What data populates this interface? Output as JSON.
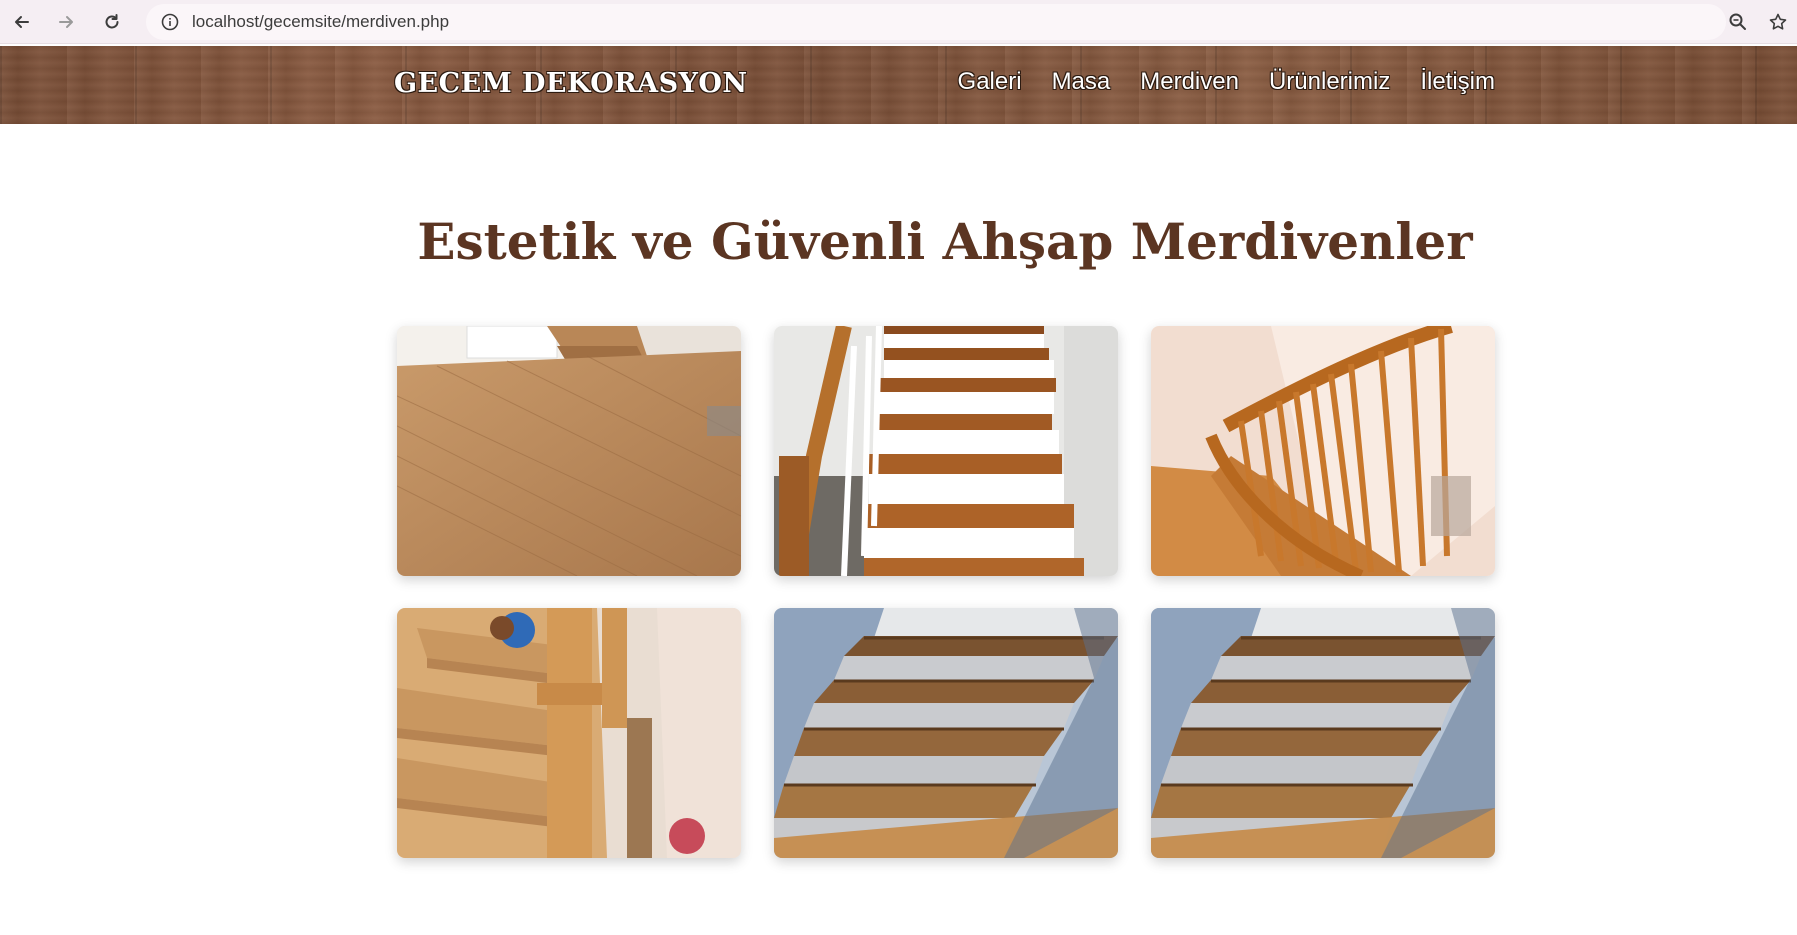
{
  "browser": {
    "url": "localhost/gecemsite/merdiven.php",
    "icons": [
      "back-arrow-icon",
      "forward-arrow-icon",
      "reload-icon",
      "site-info-icon",
      "zoom-icon",
      "bookmark-star-icon"
    ]
  },
  "header": {
    "brand": "GECEM DEKORASYON",
    "nav": [
      "Galeri",
      "Masa",
      "Merdiven",
      "Ürünlerimiz",
      "İletişim"
    ]
  },
  "main": {
    "title": "Estetik ve Güvenli Ahşap Merdivenler",
    "gallery": [
      {
        "subject": "wood parquet floor with staircase"
      },
      {
        "subject": "wooden stair treads with white balusters"
      },
      {
        "subject": "spiral staircase wooden railing"
      },
      {
        "subject": "pine wood staircase newel post"
      },
      {
        "subject": "oak stair treads with grey risers"
      },
      {
        "subject": "oak stair treads with grey risers"
      }
    ]
  },
  "colors": {
    "title": "#5b3522",
    "header_wood": "#7c5038",
    "browser_bar": "#f5eef3"
  }
}
